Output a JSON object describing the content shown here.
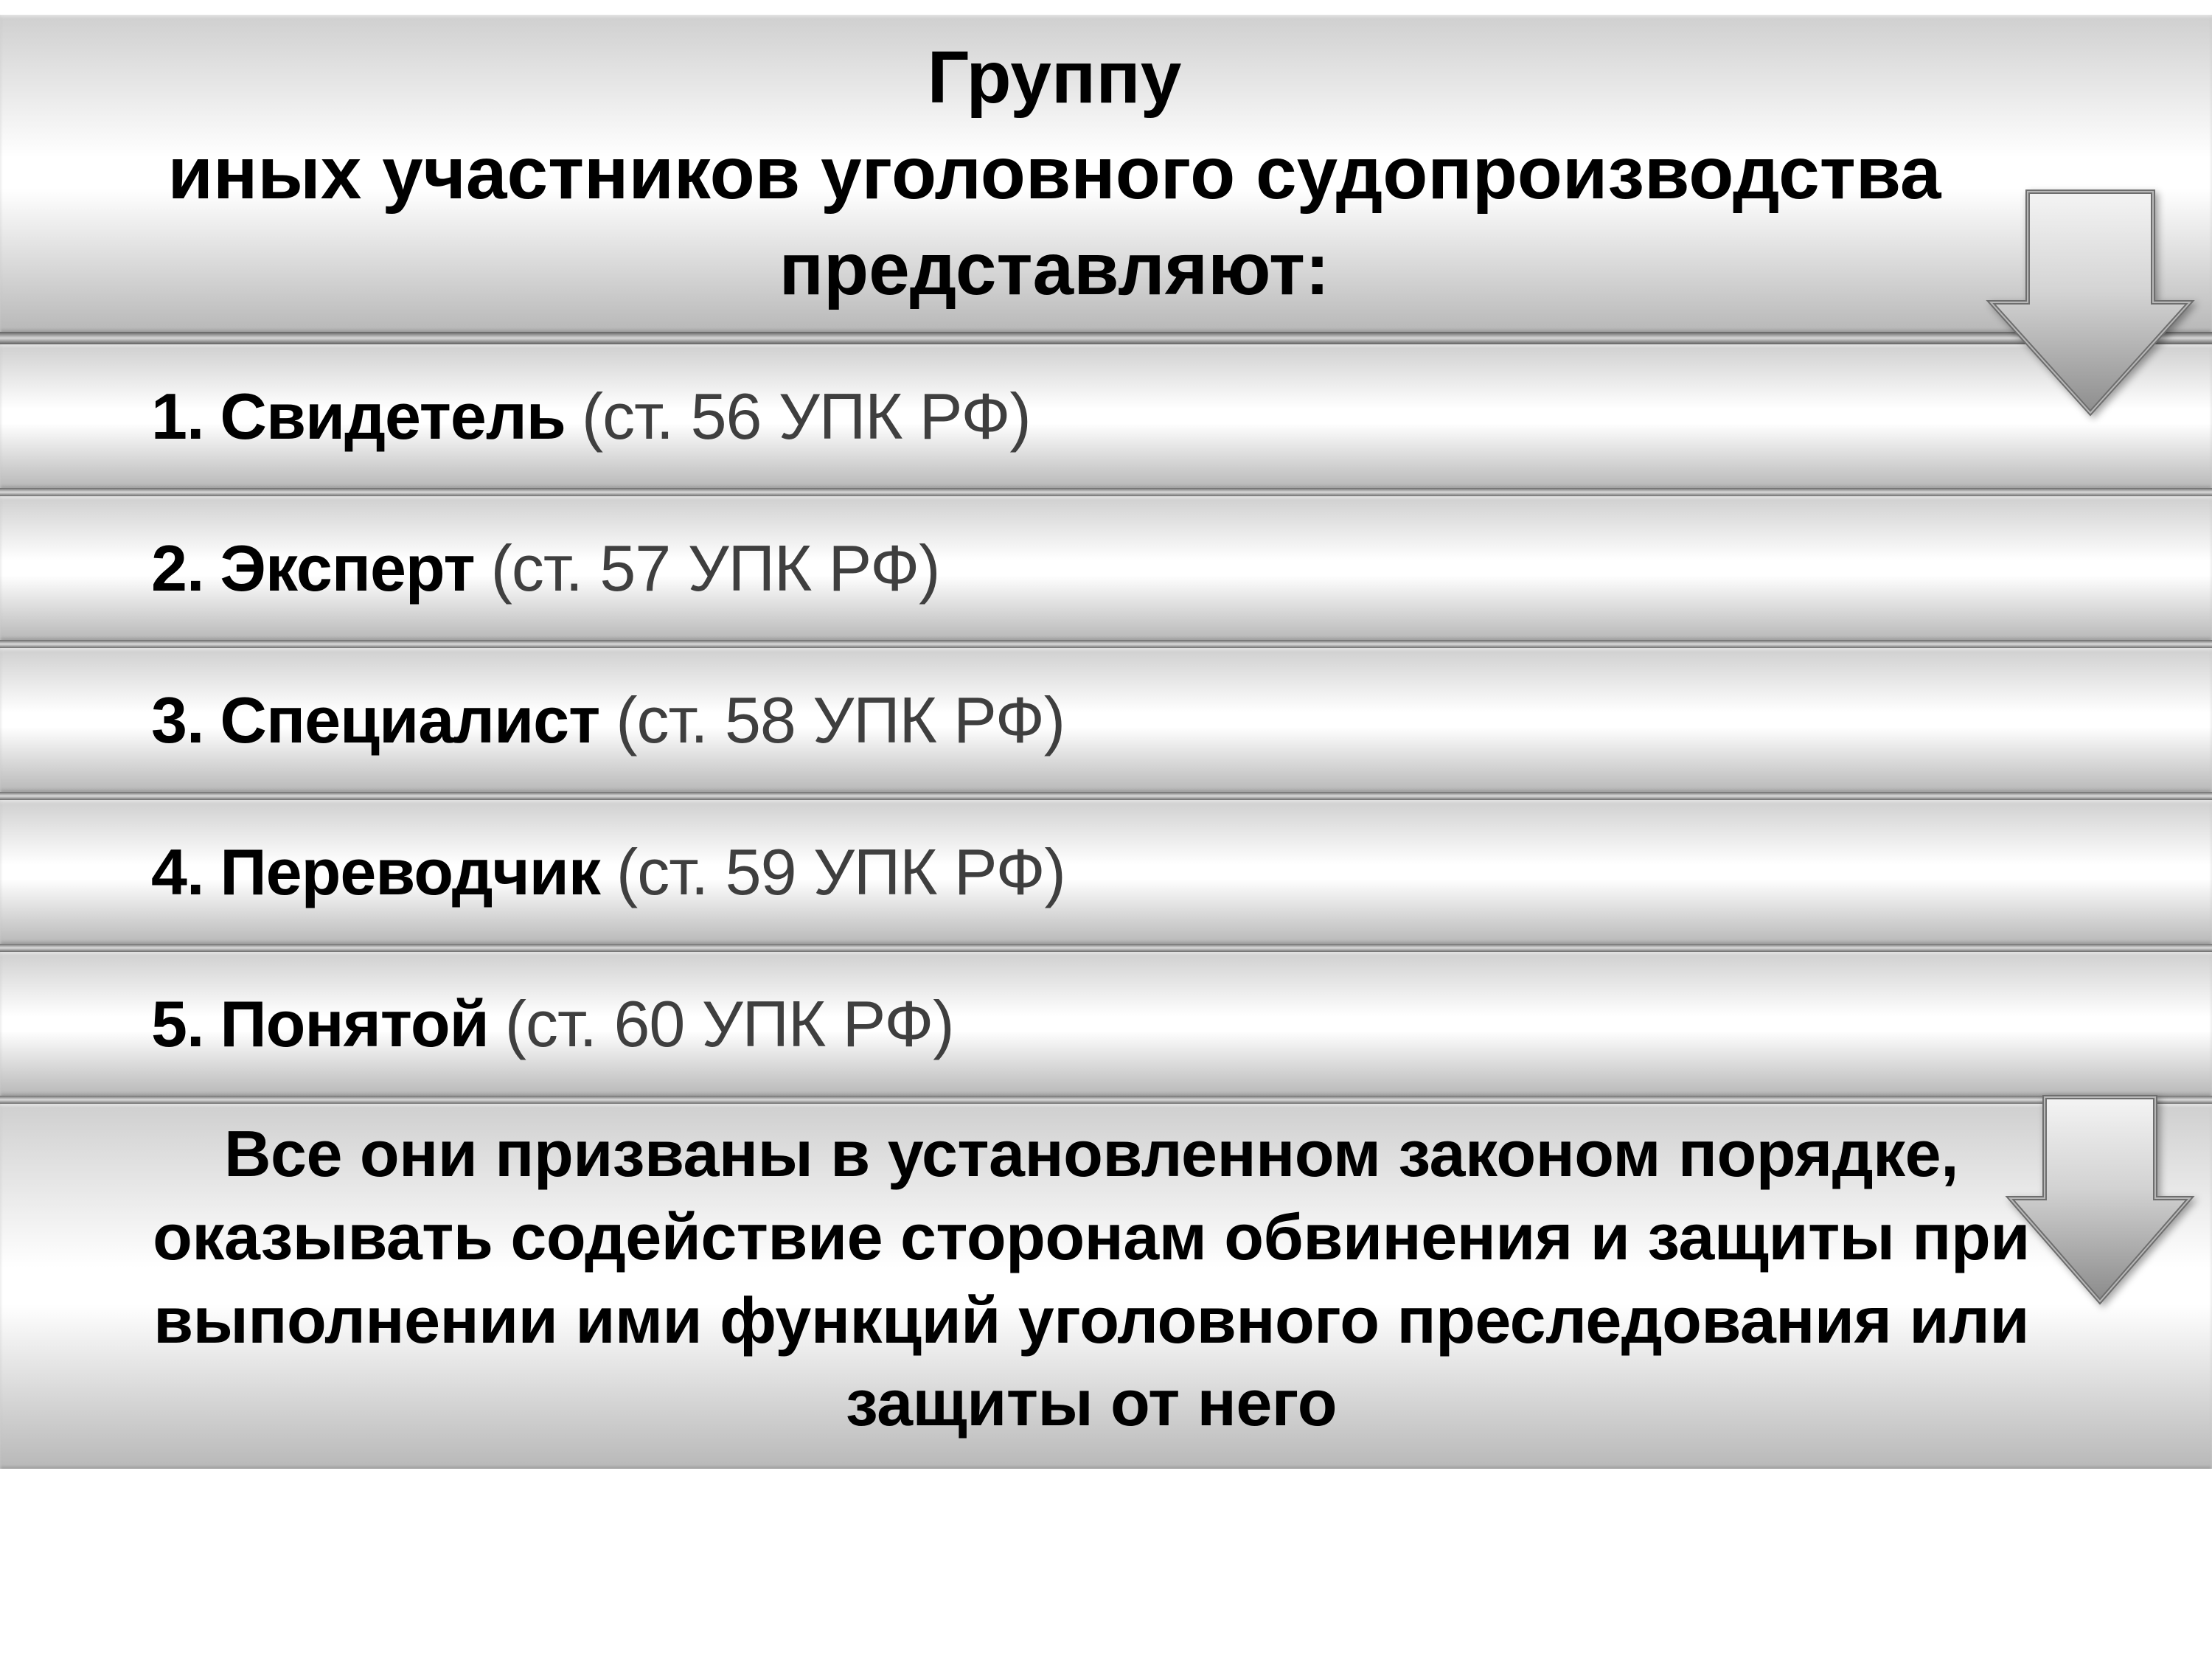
{
  "title": {
    "line1": "Группу",
    "line2": "иных участников уголовного судопроизводства",
    "line3": "представляют:"
  },
  "items": [
    {
      "num": "1.",
      "name": "Свидетель",
      "ref": "(ст. 56 УПК РФ)"
    },
    {
      "num": "2.",
      "name": "Эксперт",
      "ref": "(ст. 57 УПК РФ)"
    },
    {
      "num": "3.",
      "name": "Специалист",
      "ref": "(ст. 58 УПК РФ)"
    },
    {
      "num": "4.",
      "name": "Переводчик",
      "ref": "(ст. 59 УПК РФ)"
    },
    {
      "num": "5.",
      "name": "Понятой",
      "ref": "(ст. 60 УПК РФ)"
    }
  ],
  "footer": "Все они призваны в установленном законом порядке, оказывать содействие сторонам обвинения и защиты при выполнении ими функций уголовного преследования или защиты от него"
}
